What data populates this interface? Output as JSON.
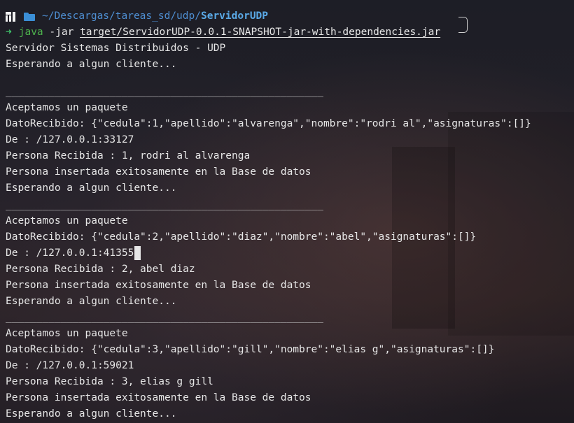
{
  "prompt": {
    "path_prefix": "~/Descargas/tareas_sd/udp/",
    "path_current": "ServidorUDP",
    "arrow": "➜",
    "command": "java",
    "arg": " -jar ",
    "file": "target/ServidorUDP-0.0.1-SNAPSHOT-jar-with-dependencies.jar"
  },
  "header_lines": [
    "Servidor Sistemas Distribuidos - UDP",
    "Esperando a algun cliente..."
  ],
  "separator": "____________________________________________________",
  "blocks": [
    {
      "accepted": "Aceptamos un paquete",
      "dato": "DatoRecibido: {\"cedula\":1,\"apellido\":\"alvarenga\",\"nombre\":\"rodri al\",\"asignaturas\":[]}",
      "from": "De : /127.0.0.1:33127",
      "persona": "Persona Recibida : 1, rodri al alvarenga",
      "inserted": "Persona insertada exitosamente en la Base de datos",
      "waiting": "Esperando a algun cliente..."
    },
    {
      "accepted": "Aceptamos un paquete",
      "dato": "DatoRecibido: {\"cedula\":2,\"apellido\":\"diaz\",\"nombre\":\"abel\",\"asignaturas\":[]}",
      "from": "De : /127.0.0.1:41355",
      "persona": "Persona Recibida : 2, abel diaz",
      "inserted": "Persona insertada exitosamente en la Base de datos",
      "waiting": "Esperando a algun cliente..."
    },
    {
      "accepted": "Aceptamos un paquete",
      "dato": "DatoRecibido: {\"cedula\":3,\"apellido\":\"gill\",\"nombre\":\"elias g\",\"asignaturas\":[]}",
      "from": "De : /127.0.0.1:59021",
      "persona": "Persona Recibida : 3, elias g gill",
      "inserted": "Persona insertada exitosamente en la Base de datos",
      "waiting": "Esperando a algun cliente..."
    }
  ],
  "icons": {
    "os": "manjaro-logo-icon",
    "folder": "folder-icon",
    "cursor": "text-cursor"
  },
  "colors": {
    "path": "#4e8ed1",
    "arrow": "#3fc46a",
    "java": "#4db34d",
    "text": "#e6e6e6"
  }
}
